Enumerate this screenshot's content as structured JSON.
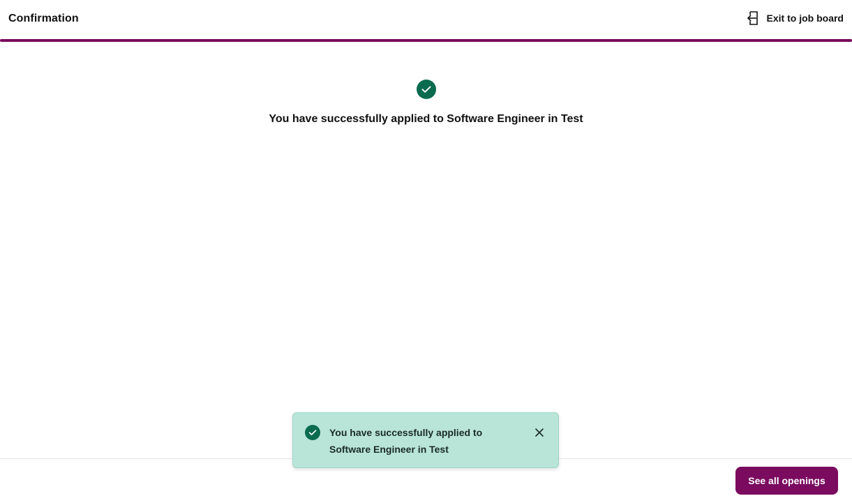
{
  "header": {
    "title": "Confirmation",
    "exit_label": "Exit to job board",
    "exit_icon": "exit-icon",
    "accent_color": "#7a0b5f"
  },
  "main": {
    "status_icon": "check-circle-icon",
    "message": "You have successfully applied to Software Engineer in Test",
    "success_color": "#0b6b4f"
  },
  "footer": {
    "see_all_label": "See all openings"
  },
  "toast": {
    "icon": "check-circle-icon",
    "message_line1": "You have successfully applied to",
    "message_line2": "Software Engineer in Test",
    "close_icon": "close-icon",
    "background_color": "#b8e5d8"
  }
}
